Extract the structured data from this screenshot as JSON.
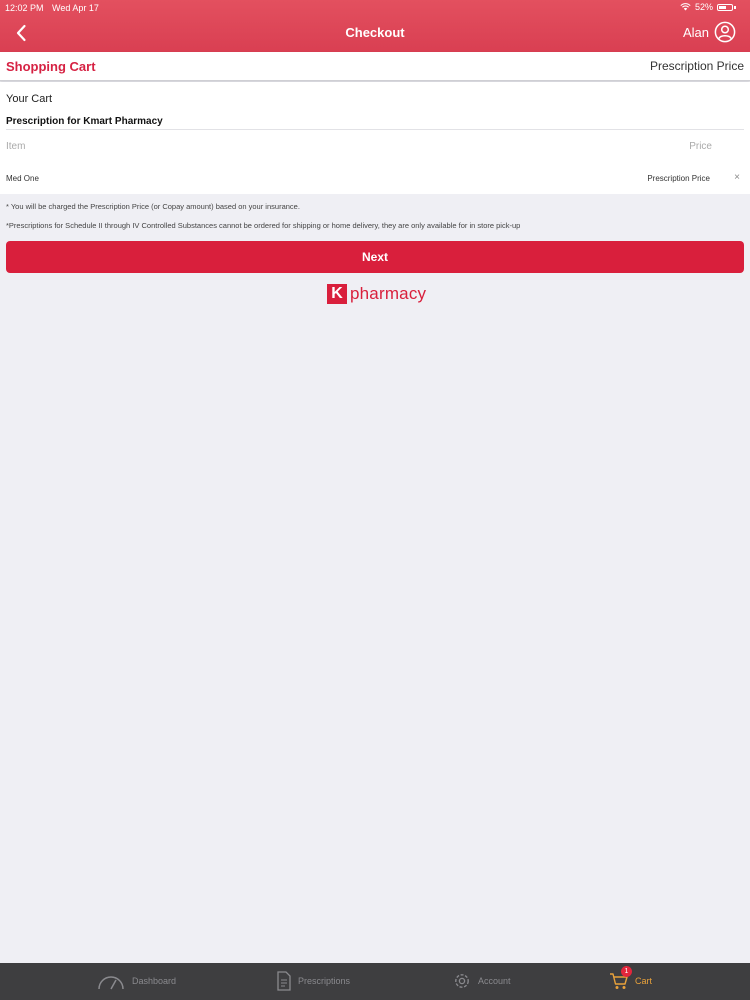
{
  "status_bar": {
    "time": "12:02 PM",
    "date": "Wed Apr 17",
    "battery": "52%"
  },
  "nav": {
    "title": "Checkout",
    "user_name": "Alan"
  },
  "cart_header": {
    "title": "Shopping Cart",
    "price_label": "Prescription Price"
  },
  "cart": {
    "heading": "Your Cart",
    "pharmacy_line": "Prescription for Kmart Pharmacy",
    "columns": {
      "item": "Item",
      "price": "Price"
    },
    "items": [
      {
        "name": "Med One",
        "price": "Prescription Price",
        "remove": "×"
      }
    ]
  },
  "notes": [
    "* You will be charged the Prescription Price (or Copay amount) based on your insurance.",
    "*Prescriptions for Schedule II through IV Controlled Substances cannot be ordered for shipping or home delivery, they are only available for in store pick-up"
  ],
  "next_label": "Next",
  "logo": {
    "mark": "K",
    "text": "pharmacy"
  },
  "tabs": {
    "dashboard": "Dashboard",
    "prescriptions": "Prescriptions",
    "account": "Account",
    "cart": "Cart",
    "cart_badge": "1"
  },
  "colors": {
    "brand": "#d91f3c",
    "header": "#e3505f",
    "tabbar": "#3e3e40",
    "active_tab": "#e9a23b"
  }
}
